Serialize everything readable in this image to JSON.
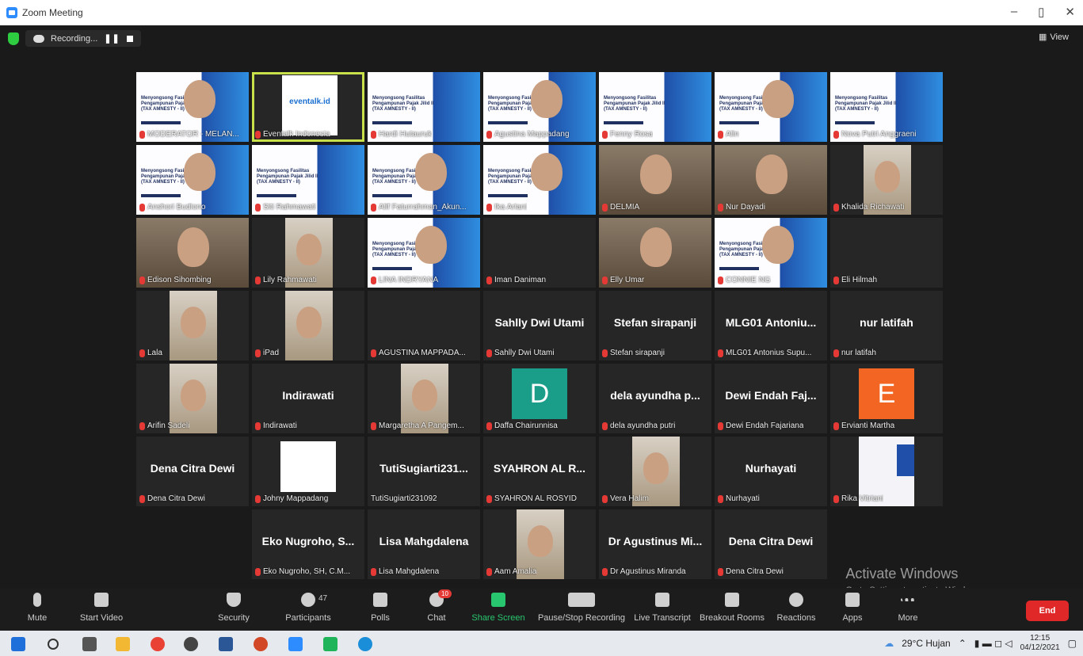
{
  "window": {
    "title": "Zoom Meeting",
    "min": "–",
    "restore": "▯",
    "close": "✕"
  },
  "recording": {
    "label": "Recording...",
    "pause": "❚❚"
  },
  "view": {
    "label": "View"
  },
  "tiles": [
    {
      "name": "MODERATOR - MELAN...",
      "kind": "person-slide"
    },
    {
      "name": "Eventalk Indonesia",
      "kind": "logo",
      "logo_text": "eventalk.id",
      "highlight": true
    },
    {
      "name": "Hardi Hutauruk",
      "kind": "slide"
    },
    {
      "name": "Agustina Mappadang",
      "kind": "person-slide"
    },
    {
      "name": "Fenny Rosa",
      "kind": "slide"
    },
    {
      "name": "Alin",
      "kind": "person-slide"
    },
    {
      "name": "Nova Putri Anggraeni",
      "kind": "slide"
    },
    {
      "name": "Anshori Budiono",
      "kind": "person-slide"
    },
    {
      "name": "Siti Rahmawati",
      "kind": "slide"
    },
    {
      "name": "Alif Faturrahman_Akun...",
      "kind": "person-slide"
    },
    {
      "name": "Ika Ariani",
      "kind": "person-slide"
    },
    {
      "name": "DELMIA",
      "kind": "photo"
    },
    {
      "name": "Nur Dayadi",
      "kind": "photo"
    },
    {
      "name": "Khalida Richawati",
      "kind": "photo-narrow"
    },
    {
      "name": "Edison Sihombing",
      "kind": "photo"
    },
    {
      "name": "Lily Rahmawati",
      "kind": "photo-narrow"
    },
    {
      "name": "LINA INDRYANA",
      "kind": "person-slide"
    },
    {
      "name": "Iman Daniman",
      "kind": "blank"
    },
    {
      "name": "Elly Umar",
      "kind": "photo"
    },
    {
      "name": "CONNIE NG",
      "kind": "person-slide"
    },
    {
      "name": "Eli Hilmah",
      "kind": "blank"
    },
    {
      "name": "Lala",
      "kind": "photo-narrow"
    },
    {
      "name": "iPad",
      "kind": "photo-narrow"
    },
    {
      "name": "AGUSTINA MAPPADA...",
      "kind": "blank"
    },
    {
      "name": "Sahlly Dwi Utami",
      "kind": "text",
      "big": "Sahlly Dwi Utami"
    },
    {
      "name": "Stefan sirapanji",
      "kind": "text",
      "big": "Stefan sirapanji"
    },
    {
      "name": "MLG01 Antonius Supu...",
      "kind": "text",
      "big": "MLG01 Antoniu..."
    },
    {
      "name": "nur latifah",
      "kind": "text",
      "big": "nur latifah"
    },
    {
      "name": "Arifin Sadeli",
      "kind": "photo-narrow"
    },
    {
      "name": "Indirawati",
      "kind": "text",
      "big": "Indirawati"
    },
    {
      "name": "Margaretha A Pangem...",
      "kind": "photo-narrow"
    },
    {
      "name": "Daffa Chairunnisa",
      "kind": "letter",
      "letter": "D",
      "color": "#1a9e8a"
    },
    {
      "name": "dela ayundha putri",
      "kind": "text",
      "big": "dela ayundha p..."
    },
    {
      "name": "Dewi Endah Fajariana",
      "kind": "text",
      "big": "Dewi Endah Faj..."
    },
    {
      "name": "Ervianti Martha",
      "kind": "letter",
      "letter": "E",
      "color": "#f26522"
    },
    {
      "name": "Dena Citra Dewi",
      "kind": "text",
      "big": "Dena Citra Dewi"
    },
    {
      "name": "Johny Mappadang",
      "kind": "white"
    },
    {
      "name": "TutiSugiarti231092",
      "kind": "text",
      "big": "TutiSugiarti231...",
      "nomic": true
    },
    {
      "name": "SYAHRON AL ROSYID",
      "kind": "text",
      "big": "SYAHRON AL R..."
    },
    {
      "name": "Vera Halim",
      "kind": "photo-narrow"
    },
    {
      "name": "Nurhayati",
      "kind": "text",
      "big": "Nurhayati"
    },
    {
      "name": "Rika Vitriani",
      "kind": "slide-narrow"
    },
    {
      "name": "Eko Nugroho, SH, C.M...",
      "kind": "text",
      "big": "Eko Nugroho, S..."
    },
    {
      "name": "Lisa Mahgdalena",
      "kind": "text",
      "big": "Lisa Mahgdalena"
    },
    {
      "name": "Aam Amalia",
      "kind": "photo-narrow"
    },
    {
      "name": "Dr Agustinus Miranda",
      "kind": "text",
      "big": "Dr Agustinus Mi..."
    },
    {
      "name": "Dena Citra Dewi",
      "kind": "text",
      "big": "Dena Citra Dewi"
    }
  ],
  "slide_text": "Menyongsong Fasilitas Pengampunan Pajak Jilid II (TAX AMNESTY - II)",
  "toolbar": {
    "mute": "Mute",
    "start_video": "Start Video",
    "security": "Security",
    "participants": "Participants",
    "participants_count": "47",
    "polls": "Polls",
    "chat": "Chat",
    "chat_badge": "10",
    "share": "Share Screen",
    "pause_rec": "Pause/Stop Recording",
    "transcript": "Live Transcript",
    "breakout": "Breakout Rooms",
    "reactions": "Reactions",
    "apps": "Apps",
    "more": "More",
    "end": "End"
  },
  "watermark": {
    "title": "Activate Windows",
    "sub": "Go to Settings to activate Windows."
  },
  "taskbar": {
    "weather": "29°C Hujan",
    "time": "12:15",
    "date": "04/12/2021"
  },
  "colors": {
    "highlight": "#c8e04a",
    "end": "#e02828",
    "share": "#28c76f"
  }
}
